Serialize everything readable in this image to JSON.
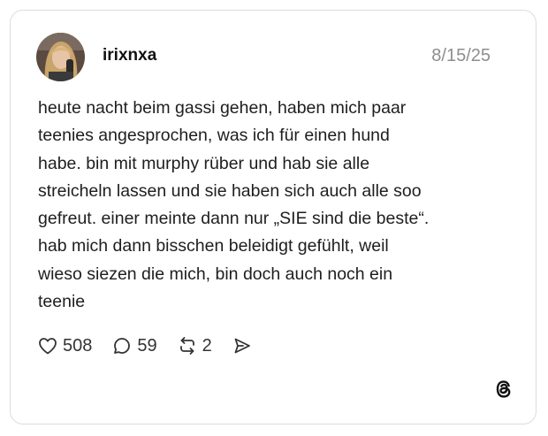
{
  "post": {
    "username": "irixnxa",
    "date": "8/15/25",
    "text_lines": [
      "heute nacht beim gassi gehen, haben mich paar",
      "teenies angesprochen, was ich für einen hund",
      "habe. bin mit murphy rüber und hab sie alle",
      "streicheln lassen und sie haben sich auch alle soo",
      "gefreut. einer meinte dann nur „SIE sind die beste“.",
      "hab mich dann bisschen beleidigt gefühlt, weil",
      "wieso siezen die mich, bin doch auch noch ein",
      "teenie"
    ]
  },
  "actions": {
    "likes": "508",
    "replies": "59",
    "reposts": "2"
  },
  "icons": {
    "like": "heart-icon",
    "reply": "comment-icon",
    "repost": "repost-icon",
    "share": "send-icon",
    "brand": "threads-logo-icon"
  }
}
